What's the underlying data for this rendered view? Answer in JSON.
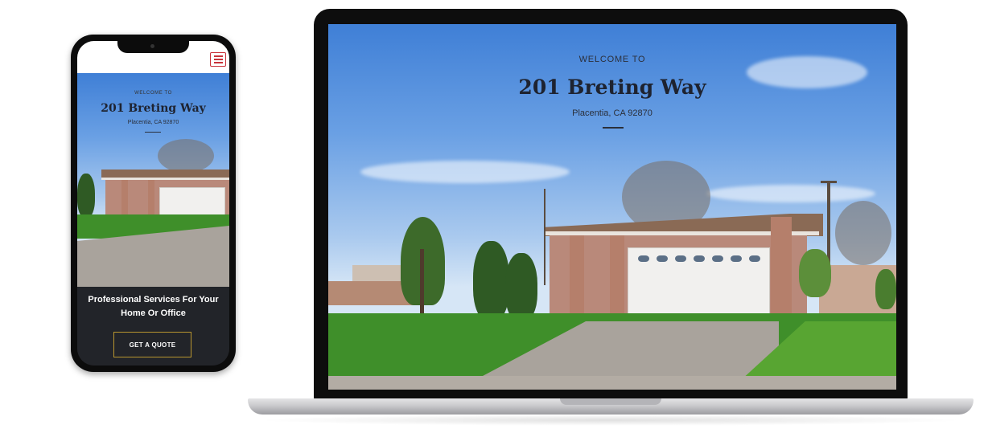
{
  "site": {
    "welcome": "WELCOME TO",
    "title": "201 Breting Way",
    "location": "Placentia, CA 92870"
  },
  "mobile": {
    "tagline": "Professional Services For Your Home Or Office",
    "cta_label": "GET A QUOTE",
    "menu_icon": "hamburger-menu-icon"
  },
  "colors": {
    "menu_accent": "#c8323a",
    "cta_border": "#b8962f",
    "dark_panel": "#222429"
  }
}
